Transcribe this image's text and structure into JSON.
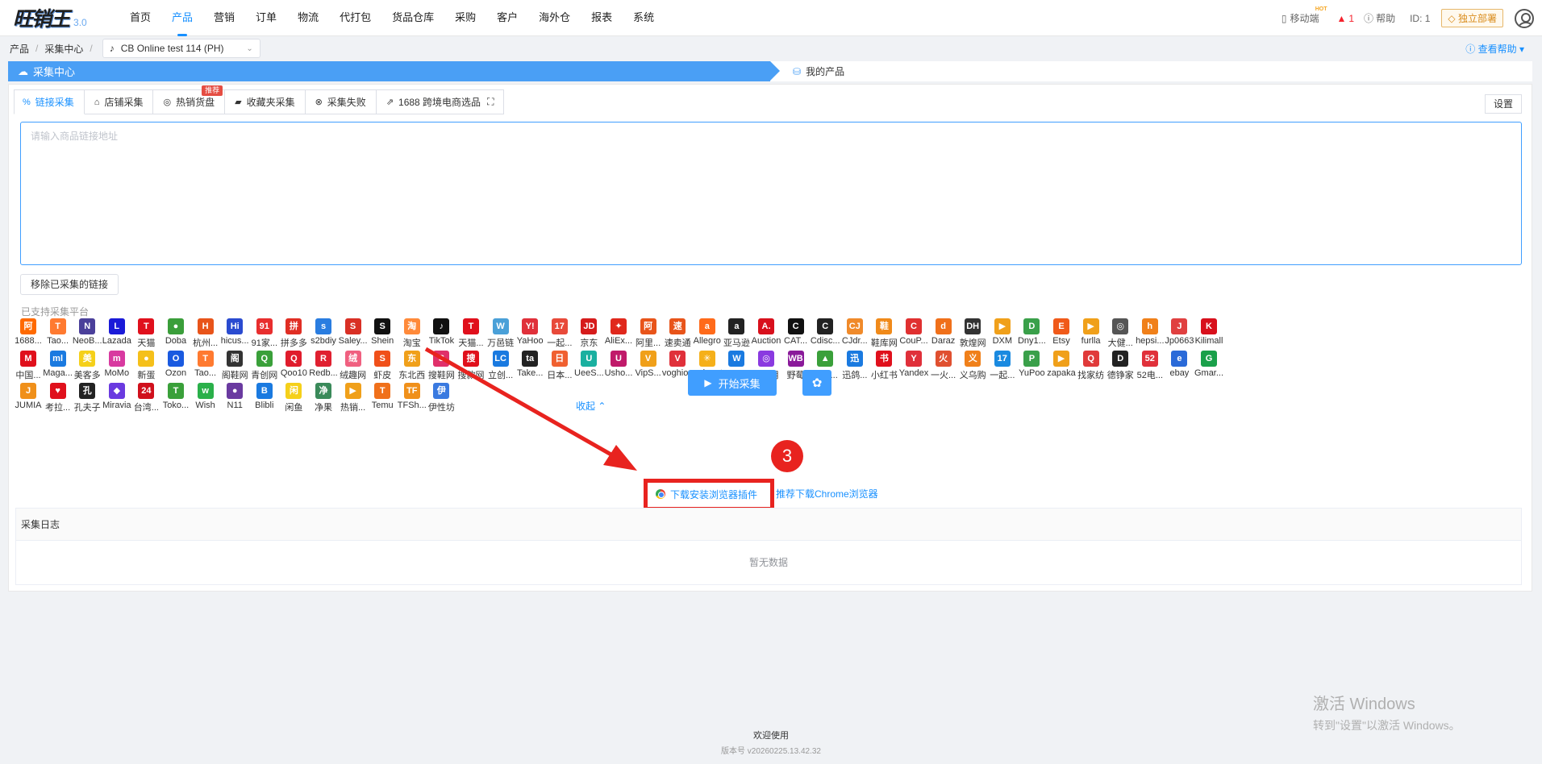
{
  "app": {
    "logo_text": "旺销王",
    "version": "3.0"
  },
  "nav": [
    {
      "label": "首页",
      "active": false
    },
    {
      "label": "产品",
      "active": true
    },
    {
      "label": "营销",
      "active": false
    },
    {
      "label": "订单",
      "active": false
    },
    {
      "label": "物流",
      "active": false
    },
    {
      "label": "代打包",
      "active": false
    },
    {
      "label": "货品仓库",
      "active": false
    },
    {
      "label": "采购",
      "active": false
    },
    {
      "label": "客户",
      "active": false
    },
    {
      "label": "海外仓",
      "active": false
    },
    {
      "label": "报表",
      "active": false
    },
    {
      "label": "系统",
      "active": false
    }
  ],
  "topright": {
    "mobile": "移动端",
    "hot": "HOT",
    "alert_count": "1",
    "help": "帮助",
    "id": "ID: 1",
    "deploy": "独立部署"
  },
  "breadcrumb": {
    "items": [
      "产品",
      "采集中心"
    ],
    "store": "CB Online test 114 (PH)",
    "help_link": "查看帮助"
  },
  "steps": {
    "current": "采集中心",
    "next": "我的产品"
  },
  "tabs": [
    {
      "icon": "link-icon",
      "glyph": "%",
      "label": "链接采集",
      "active": true
    },
    {
      "icon": "home-icon",
      "glyph": "⌂",
      "label": "店铺采集",
      "active": false
    },
    {
      "icon": "fire-icon",
      "glyph": "◎",
      "label": "热销货盘",
      "badge": "推荐",
      "active": false
    },
    {
      "icon": "folder-icon",
      "glyph": "▰",
      "label": "收藏夹采集",
      "active": false
    },
    {
      "icon": "error-icon",
      "glyph": "⊗",
      "label": "采集失败",
      "active": false
    },
    {
      "icon": "1688-icon",
      "glyph": "⇗",
      "label": "1688 跨境电商选品",
      "extra": "⛶",
      "active": false
    }
  ],
  "settings_label": "设置",
  "url_placeholder": "请输入商品链接地址",
  "remove_btn": "移除已采集的链接",
  "platform_title": "已支持采集平台",
  "platforms": [
    {
      "label": "1688...",
      "color": "#ff6a00",
      "glyph": "阿"
    },
    {
      "label": "Tao...",
      "color": "#ff7a30",
      "glyph": "T"
    },
    {
      "label": "NeoB...",
      "color": "#4a3f9a",
      "glyph": "N"
    },
    {
      "label": "Lazada",
      "color": "#1a1ad8",
      "glyph": "L"
    },
    {
      "label": "天猫",
      "color": "#e0101c",
      "glyph": "T"
    },
    {
      "label": "Doba",
      "color": "#3a9e3a",
      "glyph": "●"
    },
    {
      "label": "杭州...",
      "color": "#e8541a",
      "glyph": "H"
    },
    {
      "label": "hicus...",
      "color": "#2a4bd0",
      "glyph": "Hi"
    },
    {
      "label": "91家...",
      "color": "#e82e2e",
      "glyph": "91"
    },
    {
      "label": "拼多多",
      "color": "#e02e24",
      "glyph": "拼"
    },
    {
      "label": "s2bdiy",
      "color": "#2a7de0",
      "glyph": "s"
    },
    {
      "label": "Saley...",
      "color": "#d93025",
      "glyph": "S"
    },
    {
      "label": "Shein",
      "color": "#111111",
      "glyph": "S"
    },
    {
      "label": "淘宝",
      "color": "#ff8a3a",
      "glyph": "淘"
    },
    {
      "label": "TikTok",
      "color": "#111111",
      "glyph": "♪"
    },
    {
      "label": "天猫...",
      "color": "#e0101c",
      "glyph": "T"
    },
    {
      "label": "万邑链",
      "color": "#4aa0d8",
      "glyph": "W"
    },
    {
      "label": "YaHoo",
      "color": "#e0303a",
      "glyph": "Y!"
    },
    {
      "label": "一起...",
      "color": "#e84a3a",
      "glyph": "17"
    },
    {
      "label": "京东",
      "color": "#d61c1c",
      "glyph": "JD"
    },
    {
      "label": "AliEx...",
      "color": "#e0281c",
      "glyph": "✦"
    },
    {
      "label": "阿里...",
      "color": "#e8541a",
      "glyph": "阿"
    },
    {
      "label": "速卖通",
      "color": "#e8541a",
      "glyph": "速"
    },
    {
      "label": "Allegro",
      "color": "#ff6a1a",
      "glyph": "a"
    },
    {
      "label": "亚马逊",
      "color": "#222222",
      "glyph": "a"
    },
    {
      "label": "Auction",
      "color": "#d8101c",
      "glyph": "A."
    },
    {
      "label": "CAT...",
      "color": "#111111",
      "glyph": "C"
    },
    {
      "label": "Cdisc...",
      "color": "#222222",
      "glyph": "C"
    },
    {
      "label": "CJdr...",
      "color": "#f08a2a",
      "glyph": "CJ"
    },
    {
      "label": "鞋库网",
      "color": "#f08a1a",
      "glyph": "鞋"
    },
    {
      "label": "CouP...",
      "color": "#e03030",
      "glyph": "C"
    },
    {
      "label": "Daraz",
      "color": "#f0701a",
      "glyph": "d"
    },
    {
      "label": "敦煌网",
      "color": "#333333",
      "glyph": "DH"
    },
    {
      "label": "DXM",
      "color": "#f0a01a",
      "glyph": "▶"
    },
    {
      "label": "Dny1...",
      "color": "#3aa04a",
      "glyph": "D"
    },
    {
      "label": "Etsy",
      "color": "#f05a1a",
      "glyph": "E"
    },
    {
      "label": "furlla",
      "color": "#f0a01a",
      "glyph": "▶"
    },
    {
      "label": "大健...",
      "color": "#555555",
      "glyph": "◎"
    },
    {
      "label": "hepsi...",
      "color": "#f0801a",
      "glyph": "h"
    },
    {
      "label": "Jp0663",
      "color": "#e04040",
      "glyph": "J"
    },
    {
      "label": "Kilimall",
      "color": "#d8101c",
      "glyph": "K"
    },
    {
      "label": "中国...",
      "color": "#e0101c",
      "glyph": "M"
    },
    {
      "label": "Maga...",
      "color": "#1a7ae0",
      "glyph": "ml"
    },
    {
      "label": "美客多",
      "color": "#f5d01a",
      "glyph": "美"
    },
    {
      "label": "MoMo",
      "color": "#d83aa0",
      "glyph": "m"
    },
    {
      "label": "新蛋",
      "color": "#f5c01a",
      "glyph": "●"
    },
    {
      "label": "Ozon",
      "color": "#1a5ae0",
      "glyph": "O"
    },
    {
      "label": "Tao...",
      "color": "#ff7a30",
      "glyph": "T"
    },
    {
      "label": "阁鞋网",
      "color": "#333333",
      "glyph": "阁"
    },
    {
      "label": "青创网",
      "color": "#3aa03a",
      "glyph": "Q"
    },
    {
      "label": "Qoo10",
      "color": "#e01c2c",
      "glyph": "Q"
    },
    {
      "label": "Redb...",
      "color": "#e02030",
      "glyph": "R"
    },
    {
      "label": "绒趣网",
      "color": "#f06080",
      "glyph": "绒"
    },
    {
      "label": "虾皮",
      "color": "#f0501a",
      "glyph": "S"
    },
    {
      "label": "东北西",
      "color": "#f0a01a",
      "glyph": "东"
    },
    {
      "label": "搜鞋网",
      "color": "#e0306a",
      "glyph": "S"
    },
    {
      "label": "搜款网",
      "color": "#e0101c",
      "glyph": "搜"
    },
    {
      "label": "立创...",
      "color": "#1a7ae0",
      "glyph": "LC"
    },
    {
      "label": "Take...",
      "color": "#222222",
      "glyph": "ta"
    },
    {
      "label": "日本...",
      "color": "#f06030",
      "glyph": "日"
    },
    {
      "label": "UeeS...",
      "color": "#1ab0a0",
      "glyph": "U"
    },
    {
      "label": "Usho...",
      "color": "#c01a6a",
      "glyph": "U"
    },
    {
      "label": "VipS...",
      "color": "#f0a01a",
      "glyph": "V"
    },
    {
      "label": "voghion",
      "color": "#e0303a",
      "glyph": "V"
    },
    {
      "label": "walmart",
      "color": "#f5b01a",
      "glyph": "✳"
    },
    {
      "label": "网商园",
      "color": "#1a7ae0",
      "glyph": "W"
    },
    {
      "label": "西之月",
      "color": "#8a3ae0",
      "glyph": "◎"
    },
    {
      "label": "野莓",
      "color": "#8a1a9a",
      "glyph": "WB"
    },
    {
      "label": "微商...",
      "color": "#3aa03a",
      "glyph": "▲"
    },
    {
      "label": "迅鸽...",
      "color": "#1a7ae0",
      "glyph": "迅"
    },
    {
      "label": "小红书",
      "color": "#e0101c",
      "glyph": "书"
    },
    {
      "label": "Yandex",
      "color": "#e0303a",
      "glyph": "Y"
    },
    {
      "label": "一火...",
      "color": "#e05030",
      "glyph": "火"
    },
    {
      "label": "义乌购",
      "color": "#f0801a",
      "glyph": "义"
    },
    {
      "label": "一起...",
      "color": "#1a8ae0",
      "glyph": "17"
    },
    {
      "label": "YuPoo",
      "color": "#3aa04a",
      "glyph": "P"
    },
    {
      "label": "zapaka",
      "color": "#f0a01a",
      "glyph": "▶"
    },
    {
      "label": "找家纺",
      "color": "#e03a3a",
      "glyph": "Q"
    },
    {
      "label": "德铮家",
      "color": "#222222",
      "glyph": "D"
    },
    {
      "label": "52电...",
      "color": "#e0303a",
      "glyph": "52"
    },
    {
      "label": "ebay",
      "color": "#2a6ad8",
      "glyph": "e"
    },
    {
      "label": "Gmar...",
      "color": "#1aa04a",
      "glyph": "G"
    },
    {
      "label": "JUMIA",
      "color": "#f0901a",
      "glyph": "J"
    },
    {
      "label": "考拉...",
      "color": "#e0101c",
      "glyph": "♥"
    },
    {
      "label": "孔夫子",
      "color": "#222222",
      "glyph": "孔"
    },
    {
      "label": "Miravia",
      "color": "#6a3ae0",
      "glyph": "◆"
    },
    {
      "label": "台湾...",
      "color": "#d0101c",
      "glyph": "24"
    },
    {
      "label": "Toko...",
      "color": "#3aa03a",
      "glyph": "T"
    },
    {
      "label": "Wish",
      "color": "#2ab04a",
      "glyph": "w"
    },
    {
      "label": "N11",
      "color": "#6a3aa0",
      "glyph": "●"
    },
    {
      "label": "Blibli",
      "color": "#1a7ae0",
      "glyph": "B"
    },
    {
      "label": "闲鱼",
      "color": "#f5d01a",
      "glyph": "闲"
    },
    {
      "label": "净果",
      "color": "#3a8a5a",
      "glyph": "净"
    },
    {
      "label": "热销...",
      "color": "#f0a01a",
      "glyph": "▶"
    },
    {
      "label": "Temu",
      "color": "#f0701a",
      "glyph": "T"
    },
    {
      "label": "TFSh...",
      "color": "#f0901a",
      "glyph": "TF"
    },
    {
      "label": "伊性坊",
      "color": "#3a7ae0",
      "glyph": "伊"
    }
  ],
  "collapse_label": "收起 ⌃",
  "start_btn": "开始采集",
  "download_plugin": "下载安装浏览器插件",
  "download_chrome": "推荐下载Chrome浏览器",
  "step_number": "3",
  "log": {
    "title": "采集日志",
    "empty": "暂无数据"
  },
  "footer": {
    "welcome": "欢迎使用",
    "version": "版本号 v20260225.13.42.32"
  },
  "watermark": {
    "line1": "激活 Windows",
    "line2": "转到\"设置\"以激活 Windows。"
  }
}
